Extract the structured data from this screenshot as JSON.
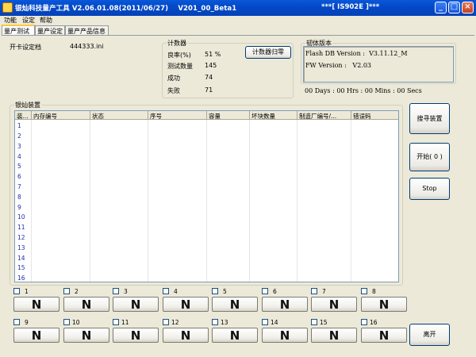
{
  "window": {
    "title": "银灿科技量产工具 V2.06.01.08(2011/06/27)    V201_00_Beta1",
    "title_right": "***[ IS902E ]***",
    "minimize": "_",
    "maximize": "□",
    "close": "×"
  },
  "menu": [
    "功能",
    "设定",
    "帮助"
  ],
  "tabs": [
    "量产测试",
    "量产设定",
    "量产产品信息"
  ],
  "card_config": {
    "label": "开卡设定档",
    "value": "444333.ini"
  },
  "counter": {
    "title": "计数器",
    "yield_label": "良率(%)",
    "yield_value": "51 %",
    "tested_label": "测试数量",
    "tested_value": "145",
    "success_label": "成功",
    "success_value": "74",
    "fail_label": "失败",
    "fail_value": "71",
    "reset_button": "计数器归零"
  },
  "firmware": {
    "title": "韧体版本",
    "flash_db": "Flash DB Version :  V3.11.12_M",
    "fw": "FW Version :   V2.03"
  },
  "timer": "00 Days : 00 Hrs : 00 Mins : 00 Secs",
  "devices": {
    "title": "银灿装置",
    "columns": [
      "装...",
      "内存编号",
      "状态",
      "序号",
      "容量",
      "坏块数量",
      "制造厂编号/...",
      "错误码"
    ],
    "rows": [
      "1",
      "2",
      "3",
      "4",
      "5",
      "6",
      "7",
      "8",
      "9",
      "10",
      "11",
      "12",
      "13",
      "14",
      "15",
      "16"
    ]
  },
  "slots": [
    {
      "num": "1",
      "state": "N"
    },
    {
      "num": "2",
      "state": "N"
    },
    {
      "num": "3",
      "state": "N"
    },
    {
      "num": "4",
      "state": "N"
    },
    {
      "num": "5",
      "state": "N"
    },
    {
      "num": "6",
      "state": "N"
    },
    {
      "num": "7",
      "state": "N"
    },
    {
      "num": "8",
      "state": "N"
    },
    {
      "num": "9",
      "state": "N"
    },
    {
      "num": "10",
      "state": "N"
    },
    {
      "num": "11",
      "state": "N"
    },
    {
      "num": "12",
      "state": "N"
    },
    {
      "num": "13",
      "state": "N"
    },
    {
      "num": "14",
      "state": "N"
    },
    {
      "num": "15",
      "state": "N"
    },
    {
      "num": "16",
      "state": "N"
    }
  ],
  "buttons": {
    "search": "搜寻装置",
    "start": "开始( 0 )",
    "stop": "Stop",
    "exit": "离开"
  }
}
